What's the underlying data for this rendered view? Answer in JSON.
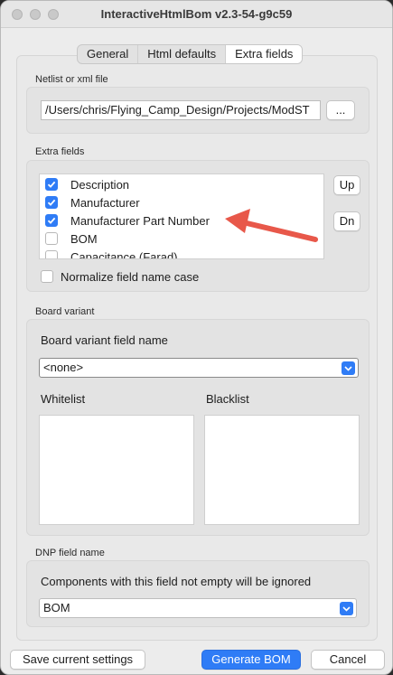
{
  "window": {
    "title": "InteractiveHtmlBom v2.3-54-g9c59"
  },
  "tabs": [
    {
      "label": "General"
    },
    {
      "label": "Html defaults"
    },
    {
      "label": "Extra fields",
      "active": true
    }
  ],
  "netlist": {
    "caption": "Netlist or xml file",
    "path": "/Users/chris/Flying_Camp_Design/Projects/ModST",
    "browse_label": "..."
  },
  "extra_fields": {
    "caption": "Extra fields",
    "items": [
      {
        "label": "Description",
        "checked": true
      },
      {
        "label": "Manufacturer",
        "checked": true
      },
      {
        "label": "Manufacturer Part Number",
        "checked": true
      },
      {
        "label": "BOM",
        "checked": false
      },
      {
        "label": "Capacitance (Farad)",
        "checked": false
      }
    ],
    "up_label": "Up",
    "down_label": "Dn",
    "normalize_label": "Normalize field name case"
  },
  "board_variant": {
    "caption": "Board variant",
    "field_label": "Board variant field name",
    "selected": "<none>",
    "whitelist_label": "Whitelist",
    "blacklist_label": "Blacklist"
  },
  "dnp": {
    "caption": "DNP field name",
    "description": "Components with this field not empty will be ignored",
    "selected": "BOM"
  },
  "footer": {
    "save_label": "Save current settings",
    "generate_label": "Generate BOM",
    "cancel_label": "Cancel"
  },
  "colors": {
    "accent": "#2f7cf6",
    "annotation": "#e8584a",
    "window_bg": "#ececec"
  }
}
